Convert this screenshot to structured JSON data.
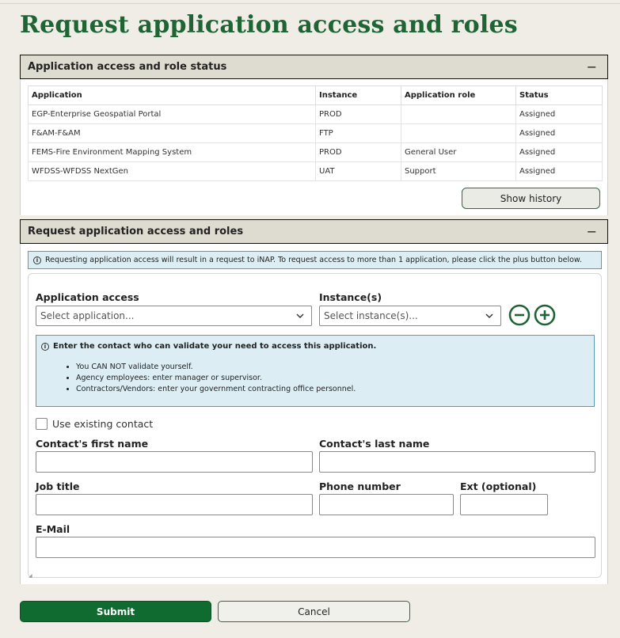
{
  "page": {
    "title": "Request application access and roles"
  },
  "status_panel": {
    "header": "Application access and role status",
    "collapse_glyph": "−",
    "columns": [
      "Application",
      "Instance",
      "Application role",
      "Status"
    ],
    "rows": [
      [
        "EGP-Enterprise Geospatial Portal",
        "PROD",
        "",
        "Assigned"
      ],
      [
        "F&AM-F&AM",
        "FTP",
        "",
        "Assigned"
      ],
      [
        "FEMS-Fire Environment Mapping System",
        "PROD",
        "General User",
        "Assigned"
      ],
      [
        "WFDSS-WFDSS NextGen",
        "UAT",
        "Support",
        "Assigned"
      ]
    ],
    "show_history_label": "Show history"
  },
  "request_panel": {
    "header": "Request application access and roles",
    "collapse_glyph": "−",
    "info_text": "Requesting application access will result in a request to iNAP. To request access to more than 1 application, please click the plus button below.",
    "application_access_label": "Application access",
    "application_placeholder": "Select application...",
    "instances_label": "Instance(s)",
    "instances_placeholder": "Select instance(s)...",
    "contact_info": {
      "heading": "Enter the contact who can validate your need to access this application.",
      "bullets": [
        "You CAN NOT validate yourself.",
        "Agency employees: enter manager or supervisor.",
        "Contractors/Vendors: enter your government contracting office personnel."
      ]
    },
    "use_existing_contact_label": "Use existing contact",
    "first_name_label": "Contact's first name",
    "last_name_label": "Contact's last name",
    "job_title_label": "Job title",
    "phone_label": "Phone number",
    "ext_label": "Ext (optional)",
    "email_label": "E-Mail"
  },
  "actions": {
    "submit_label": "Submit",
    "cancel_label": "Cancel"
  },
  "colors": {
    "brand_green": "#1e6434",
    "submit_green": "#0f6b2f",
    "info_blue_bg": "#dceef3",
    "page_bg": "#efede6",
    "header_bg": "#dedbd0"
  },
  "icons": [
    "collapse-icon",
    "info-icon",
    "chevron-down-icon",
    "remove-circle-icon",
    "add-circle-icon"
  ]
}
